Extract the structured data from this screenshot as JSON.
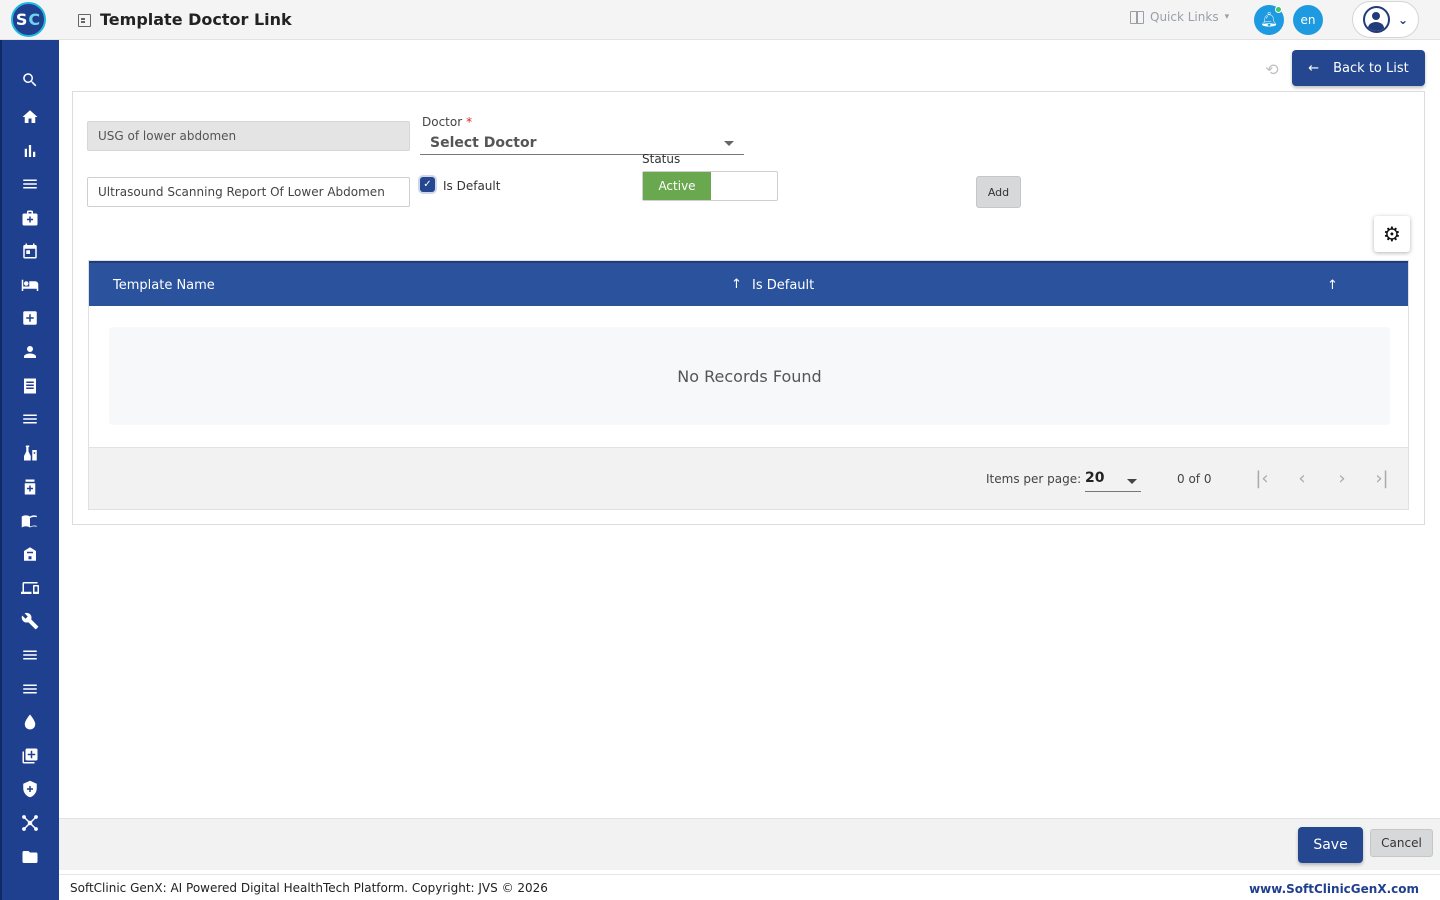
{
  "app": {
    "logo_text_s": "S",
    "logo_text_c": "C",
    "page_title": "Template Doctor Link"
  },
  "header": {
    "quick_links_label": "Quick Links",
    "language": "en"
  },
  "sidebar": {
    "icons": [
      "search-icon",
      "home-icon",
      "bar-chart-icon",
      "menu-icon",
      "medical-bag-icon",
      "calendar-icon",
      "bed-icon",
      "medical-plus-icon",
      "person-icon",
      "receipt-icon",
      "list-icon",
      "lab-icon",
      "pharmacy-icon",
      "book-icon",
      "building-icon",
      "devices-icon",
      "wrench-icon",
      "menu-icon-2",
      "menu-icon-3",
      "drop-icon",
      "add-box-icon",
      "shield-icon",
      "network-icon",
      "folder-icon"
    ]
  },
  "toolbar": {
    "back_label": "Back to List"
  },
  "form": {
    "template_short_value": "USG of lower abdomen",
    "template_full_value": "Ultrasound Scanning Report Of Lower Abdomen",
    "doctor_label": "Doctor",
    "doctor_required_mark": "*",
    "doctor_placeholder": "Select Doctor",
    "is_default_label": "Is Default",
    "is_default_checked": true,
    "status_label": "Status",
    "status_active_label": "Active",
    "add_label": "Add"
  },
  "table": {
    "columns": [
      "Template Name",
      "Is Default"
    ],
    "empty_message": "No Records Found",
    "items_per_page_label": "Items per page:",
    "items_per_page_value": "20",
    "range_label": "0 of 0"
  },
  "actions": {
    "save_label": "Save",
    "cancel_label": "Cancel"
  },
  "footer": {
    "copyright": "SoftClinic GenX: AI Powered Digital HealthTech Platform. Copyright: JVS © 2026",
    "website": "www.SoftClinicGenX.com"
  },
  "colors": {
    "primary": "#24478f",
    "sidebar": "#1f3f8f",
    "table_header": "#2b529c",
    "active_green": "#6aa84f",
    "notify_blue": "#1e9be0"
  }
}
